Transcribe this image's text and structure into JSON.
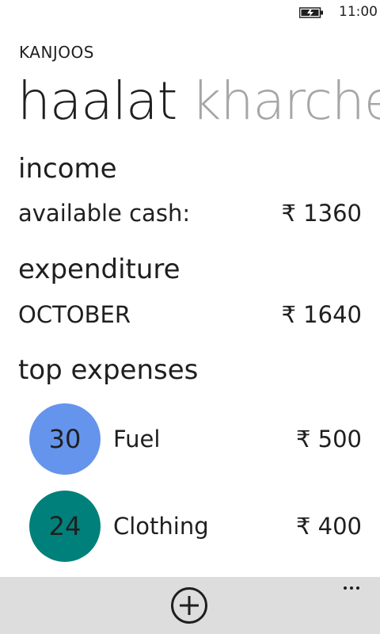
{
  "status_bar": {
    "time": "11:00",
    "battery_icon": "battery-charging-icon"
  },
  "app": {
    "title": "KANJOOS"
  },
  "pivot": {
    "items": [
      {
        "label": "haalat"
      },
      {
        "label": "kharche"
      }
    ]
  },
  "income": {
    "title": "income",
    "row_label": "available cash:",
    "row_value": "₹ 1360"
  },
  "expenditure": {
    "title": "expenditure",
    "row_label": "OCTOBER",
    "row_value": "₹ 1640"
  },
  "top_expenses": {
    "title": "top expenses",
    "items": [
      {
        "percent": "30",
        "name": "Fuel",
        "amount": "₹ 500",
        "color": "#6594ec"
      },
      {
        "percent": "24",
        "name": "Clothing",
        "amount": "₹ 400",
        "color": "#00807a"
      }
    ]
  },
  "app_bar": {
    "add_icon": "add-icon",
    "more_icon": "more-icon",
    "background": "#dddddd"
  }
}
